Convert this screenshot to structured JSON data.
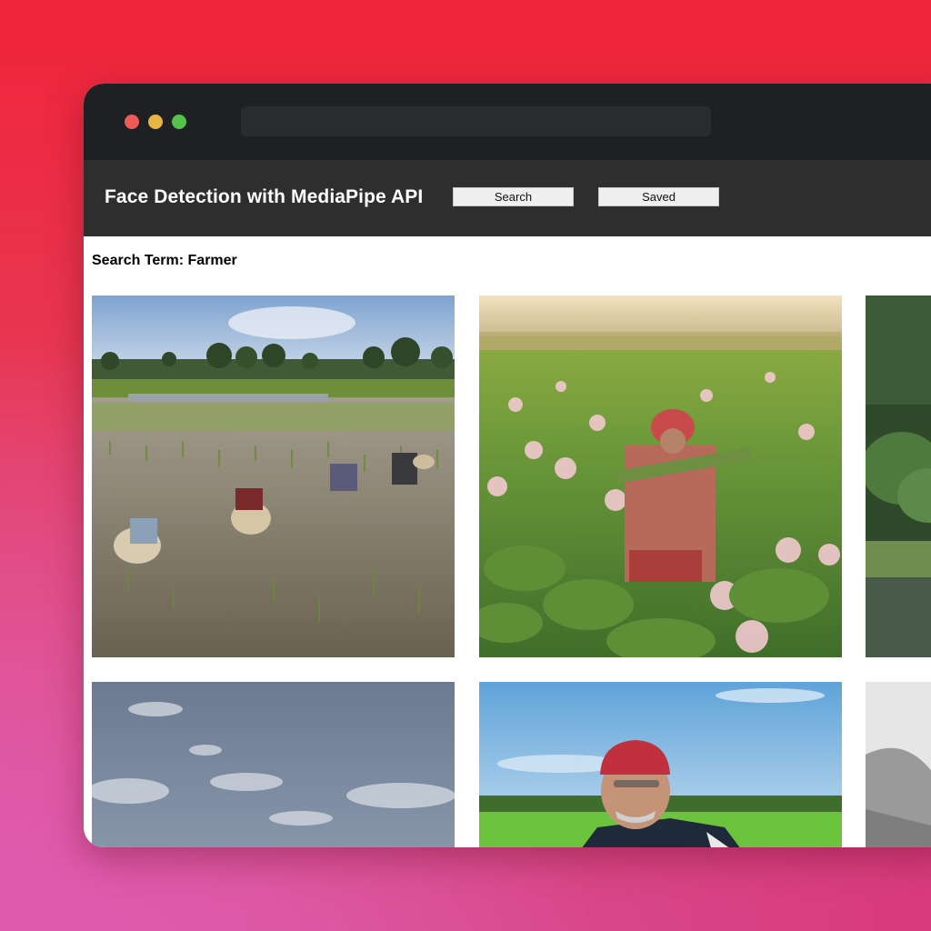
{
  "app": {
    "title": "Face Detection with MediaPipe API",
    "nav": {
      "search_label": "Search",
      "saved_label": "Saved"
    },
    "search_term_text": "Search Term: Farmer"
  },
  "window": {
    "controls": [
      "close-dot",
      "minimize-dot",
      "maximize-dot"
    ]
  },
  "results": [
    {
      "subject": "rice-paddy-farmers"
    },
    {
      "subject": "lotus-field-farmer"
    },
    {
      "subject": "forest-pond"
    },
    {
      "subject": "cloudy-sky"
    },
    {
      "subject": "farmer-red-cap"
    },
    {
      "subject": "misty-mountain"
    }
  ],
  "colors": {
    "titlebar": "#1f2023",
    "app_header": "#2e2e2f",
    "button_bg": "#efefef",
    "close": "#ee5a55",
    "minimize": "#e7b543",
    "maximize": "#55c04a"
  }
}
